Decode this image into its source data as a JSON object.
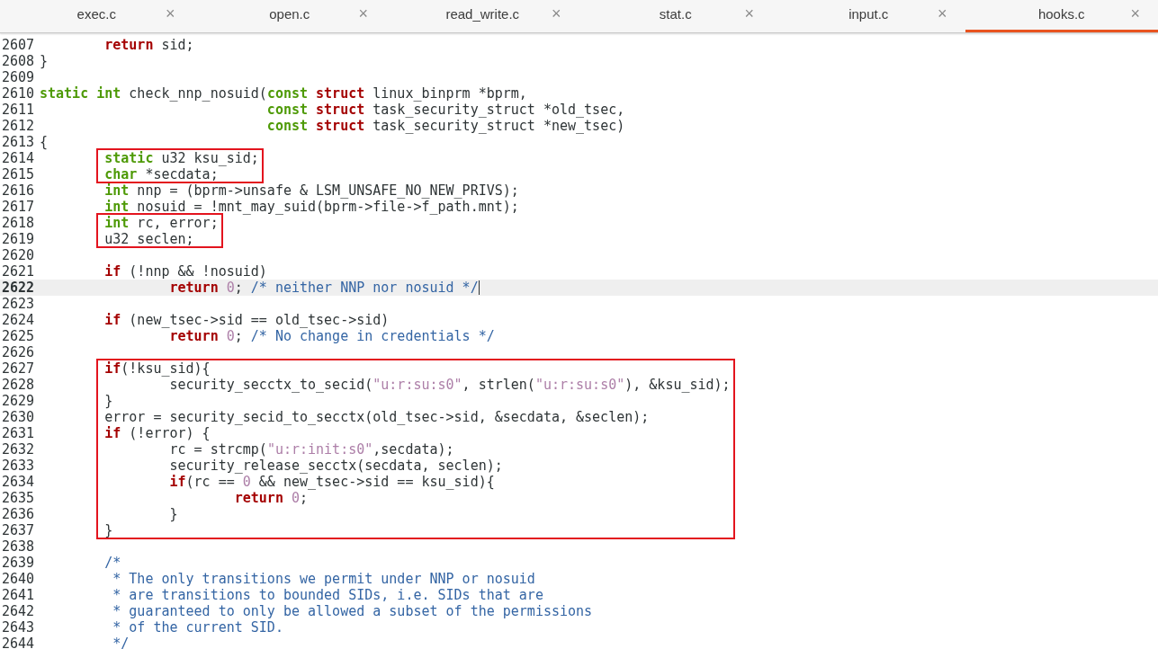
{
  "tabs": [
    {
      "label": "exec.c",
      "selected": false
    },
    {
      "label": "open.c",
      "selected": false
    },
    {
      "label": "read_write.c",
      "selected": false
    },
    {
      "label": "stat.c",
      "selected": false
    },
    {
      "label": "input.c",
      "selected": false
    },
    {
      "label": "hooks.c",
      "selected": true
    }
  ],
  "close_glyph": "×",
  "editor": {
    "items": [
      {
        "kind": "line",
        "number": "2607",
        "current": false,
        "code": [
          {
            "kind": "kw",
            "s": "        return"
          },
          {
            "kind": "plain",
            "s": " sid;"
          }
        ]
      },
      {
        "kind": "line",
        "number": "2608",
        "current": false,
        "code": [
          {
            "kind": "plain",
            "s": "}"
          }
        ]
      },
      {
        "kind": "line",
        "number": "2609",
        "current": false
      },
      {
        "kind": "line",
        "number": "2610",
        "current": false,
        "code": [
          {
            "kind": "type",
            "s": "static "
          },
          {
            "kind": "type",
            "s": "int"
          },
          {
            "kind": "plain",
            "s": " check_nnp_nosuid("
          },
          {
            "kind": "type",
            "s": "const "
          },
          {
            "kind": "kw",
            "s": "struct"
          },
          {
            "kind": "plain",
            "s": " linux_binprm *bprm,"
          }
        ]
      },
      {
        "kind": "line",
        "number": "2611",
        "current": false,
        "code": [
          {
            "kind": "type",
            "s": "                            const "
          },
          {
            "kind": "kw",
            "s": "struct"
          },
          {
            "kind": "plain",
            "s": " task_security_struct *old_tsec,"
          }
        ]
      },
      {
        "kind": "line",
        "number": "2612",
        "current": false,
        "code": [
          {
            "kind": "type",
            "s": "                            const "
          },
          {
            "kind": "kw",
            "s": "struct"
          },
          {
            "kind": "plain",
            "s": " task_security_struct *new_tsec)"
          }
        ]
      },
      {
        "kind": "line",
        "number": "2613",
        "current": false,
        "code": [
          {
            "kind": "plain",
            "s": "{"
          }
        ]
      },
      {
        "kind": "annotation_box",
        "children": [
          {
            "kind": "line",
            "number": "2614",
            "current": false,
            "code": [
              {
                "kind": "type",
                "s": "        static"
              },
              {
                "kind": "plain",
                "s": " u32 ksu_sid;"
              }
            ]
          },
          {
            "kind": "line",
            "number": "2615",
            "current": false,
            "code": [
              {
                "kind": "type",
                "s": "        char"
              },
              {
                "kind": "plain",
                "s": " *secdata;"
              }
            ]
          }
        ]
      },
      {
        "kind": "line",
        "number": "2616",
        "current": false,
        "code": [
          {
            "kind": "type",
            "s": "        int"
          },
          {
            "kind": "plain",
            "s": " nnp = (bprm->unsafe & LSM_UNSAFE_NO_NEW_PRIVS);"
          }
        ]
      },
      {
        "kind": "line",
        "number": "2617",
        "current": false,
        "code": [
          {
            "kind": "type",
            "s": "        int"
          },
          {
            "kind": "plain",
            "s": " nosuid = !mnt_may_suid(bprm->file->f_path.mnt);"
          }
        ]
      },
      {
        "kind": "annotation_box",
        "children": [
          {
            "kind": "line",
            "number": "2618",
            "current": false,
            "code": [
              {
                "kind": "type",
                "s": "        int"
              },
              {
                "kind": "plain",
                "s": " rc, error;"
              }
            ]
          },
          {
            "kind": "line",
            "number": "2619",
            "current": false,
            "code": [
              {
                "kind": "plain",
                "s": "        u32 seclen;"
              }
            ]
          }
        ]
      },
      {
        "kind": "line",
        "number": "2620",
        "current": false
      },
      {
        "kind": "line",
        "number": "2621",
        "current": false,
        "code": [
          {
            "kind": "kw",
            "s": "        if"
          },
          {
            "kind": "plain",
            "s": " (!nnp && !nosuid)"
          }
        ]
      },
      {
        "kind": "line",
        "number": "2622",
        "current": true,
        "code": [
          {
            "kind": "kw",
            "s": "                return "
          },
          {
            "kind": "num",
            "s": "0"
          },
          {
            "kind": "plain",
            "s": "; "
          },
          {
            "kind": "comment",
            "s": "/* neither NNP nor nosuid */"
          }
        ]
      },
      {
        "kind": "line",
        "number": "2623",
        "current": false
      },
      {
        "kind": "line",
        "number": "2624",
        "current": false,
        "code": [
          {
            "kind": "kw",
            "s": "        if"
          },
          {
            "kind": "plain",
            "s": " (new_tsec->sid == old_tsec->sid)"
          }
        ]
      },
      {
        "kind": "line",
        "number": "2625",
        "current": false,
        "code": [
          {
            "kind": "kw",
            "s": "                return "
          },
          {
            "kind": "num",
            "s": "0"
          },
          {
            "kind": "plain",
            "s": "; "
          },
          {
            "kind": "comment",
            "s": "/* No change in credentials */"
          }
        ]
      },
      {
        "kind": "line",
        "number": "2626",
        "current": false
      },
      {
        "kind": "annotation_box",
        "children": [
          {
            "kind": "line",
            "number": "2627",
            "current": false,
            "code": [
              {
                "kind": "kw",
                "s": "        if"
              },
              {
                "kind": "plain",
                "s": "(!ksu_sid){"
              }
            ]
          },
          {
            "kind": "line",
            "number": "2628",
            "current": false,
            "code": [
              {
                "kind": "plain",
                "s": "                security_secctx_to_secid("
              },
              {
                "kind": "str",
                "s": "\"u:r:su:s0\""
              },
              {
                "kind": "plain",
                "s": ", strlen("
              },
              {
                "kind": "str",
                "s": "\"u:r:su:s0\""
              },
              {
                "kind": "plain",
                "s": "), &ksu_sid);"
              }
            ]
          },
          {
            "kind": "line",
            "number": "2629",
            "current": false,
            "code": [
              {
                "kind": "plain",
                "s": "        }"
              }
            ]
          },
          {
            "kind": "line",
            "number": "2630",
            "current": false,
            "code": [
              {
                "kind": "plain",
                "s": "        error = security_secid_to_secctx(old_tsec->sid, &secdata, &seclen);"
              }
            ]
          },
          {
            "kind": "line",
            "number": "2631",
            "current": false,
            "code": [
              {
                "kind": "kw",
                "s": "        if"
              },
              {
                "kind": "plain",
                "s": " (!error) {"
              }
            ]
          },
          {
            "kind": "line",
            "number": "2632",
            "current": false,
            "code": [
              {
                "kind": "plain",
                "s": "                rc = strcmp("
              },
              {
                "kind": "str",
                "s": "\"u:r:init:s0\""
              },
              {
                "kind": "plain",
                "s": ",secdata);"
              }
            ]
          },
          {
            "kind": "line",
            "number": "2633",
            "current": false,
            "code": [
              {
                "kind": "plain",
                "s": "                security_release_secctx(secdata, seclen);"
              }
            ]
          },
          {
            "kind": "line",
            "number": "2634",
            "current": false,
            "code": [
              {
                "kind": "kw",
                "s": "                if"
              },
              {
                "kind": "plain",
                "s": "(rc == "
              },
              {
                "kind": "num",
                "s": "0"
              },
              {
                "kind": "plain",
                "s": " && new_tsec->sid == ksu_sid){"
              }
            ]
          },
          {
            "kind": "line",
            "number": "2635",
            "current": false,
            "code": [
              {
                "kind": "kw",
                "s": "                        return "
              },
              {
                "kind": "num",
                "s": "0"
              },
              {
                "kind": "plain",
                "s": ";"
              }
            ]
          },
          {
            "kind": "line",
            "number": "2636",
            "current": false,
            "code": [
              {
                "kind": "plain",
                "s": "                }"
              }
            ]
          },
          {
            "kind": "line",
            "number": "2637",
            "current": false,
            "code": [
              {
                "kind": "plain",
                "s": "        }"
              }
            ]
          }
        ]
      },
      {
        "kind": "line",
        "number": "2638",
        "current": false
      },
      {
        "kind": "line",
        "number": "2639",
        "current": false,
        "code": [
          {
            "kind": "comment",
            "s": "        /*"
          }
        ]
      },
      {
        "kind": "line",
        "number": "2640",
        "current": false,
        "code": [
          {
            "kind": "comment",
            "s": "         * The only transitions we permit under NNP or nosuid"
          }
        ]
      },
      {
        "kind": "line",
        "number": "2641",
        "current": false,
        "code": [
          {
            "kind": "comment",
            "s": "         * are transitions to bounded SIDs, i.e. SIDs that are"
          }
        ]
      },
      {
        "kind": "line",
        "number": "2642",
        "current": false,
        "code": [
          {
            "kind": "comment",
            "s": "         * guaranteed to only be allowed a subset of the permissions"
          }
        ]
      },
      {
        "kind": "line",
        "number": "2643",
        "current": false,
        "code": [
          {
            "kind": "comment",
            "s": "         * of the current SID."
          }
        ]
      },
      {
        "kind": "line",
        "number": "2644",
        "current": false,
        "code": [
          {
            "kind": "comment",
            "s": "         */"
          }
        ]
      }
    ]
  }
}
